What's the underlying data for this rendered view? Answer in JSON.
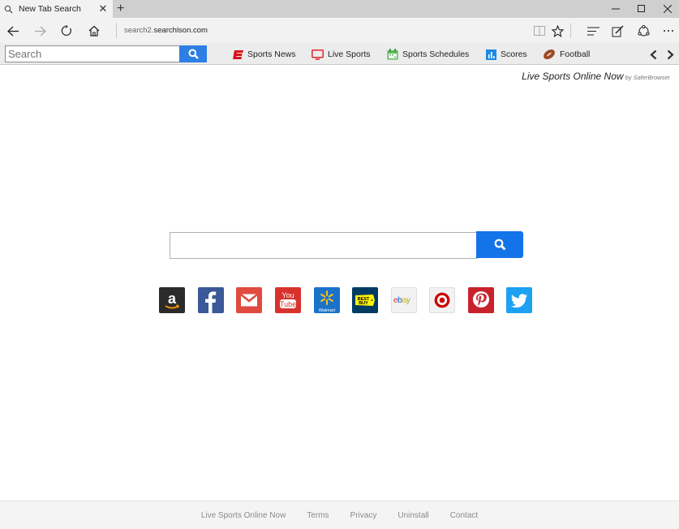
{
  "browser": {
    "tab_title": "New Tab Search",
    "new_tab_symbol": "+",
    "url_prefix": "search2.",
    "url_host": "searchlson.com"
  },
  "toolbar": {
    "search_placeholder": "Search",
    "links": [
      {
        "label": "Sports News",
        "icon": "espn-icon"
      },
      {
        "label": "Live Sports",
        "icon": "tv-icon"
      },
      {
        "label": "Sports Schedules",
        "icon": "calendar-icon"
      },
      {
        "label": "Scores",
        "icon": "bar-chart-icon"
      },
      {
        "label": "Football",
        "icon": "football-icon"
      }
    ]
  },
  "brand": {
    "name": "Live Sports Online Now",
    "by": "by SaferBrowser"
  },
  "quick_links": [
    {
      "name": "amazon",
      "color": "#2b2b2b"
    },
    {
      "name": "facebook",
      "color": "#3b5998"
    },
    {
      "name": "gmail",
      "color": "#e04a3f"
    },
    {
      "name": "youtube",
      "color": "#d8322d"
    },
    {
      "name": "walmart",
      "color": "#1a73c9",
      "label": "Walmart"
    },
    {
      "name": "bestbuy",
      "color": "#003b64",
      "label": "BEST BUY"
    },
    {
      "name": "ebay",
      "color": "#f2f2f2",
      "label": "ebay"
    },
    {
      "name": "target",
      "color": "#f2f2f2"
    },
    {
      "name": "pinterest",
      "color": "#c8232c"
    },
    {
      "name": "twitter",
      "color": "#1da1f2"
    }
  ],
  "footer": {
    "links": [
      "Live Sports Online Now",
      "Terms",
      "Privacy",
      "Uninstall",
      "Contact"
    ]
  },
  "colors": {
    "accent": "#1373e8",
    "toolbar_button": "#2d7fe3"
  }
}
